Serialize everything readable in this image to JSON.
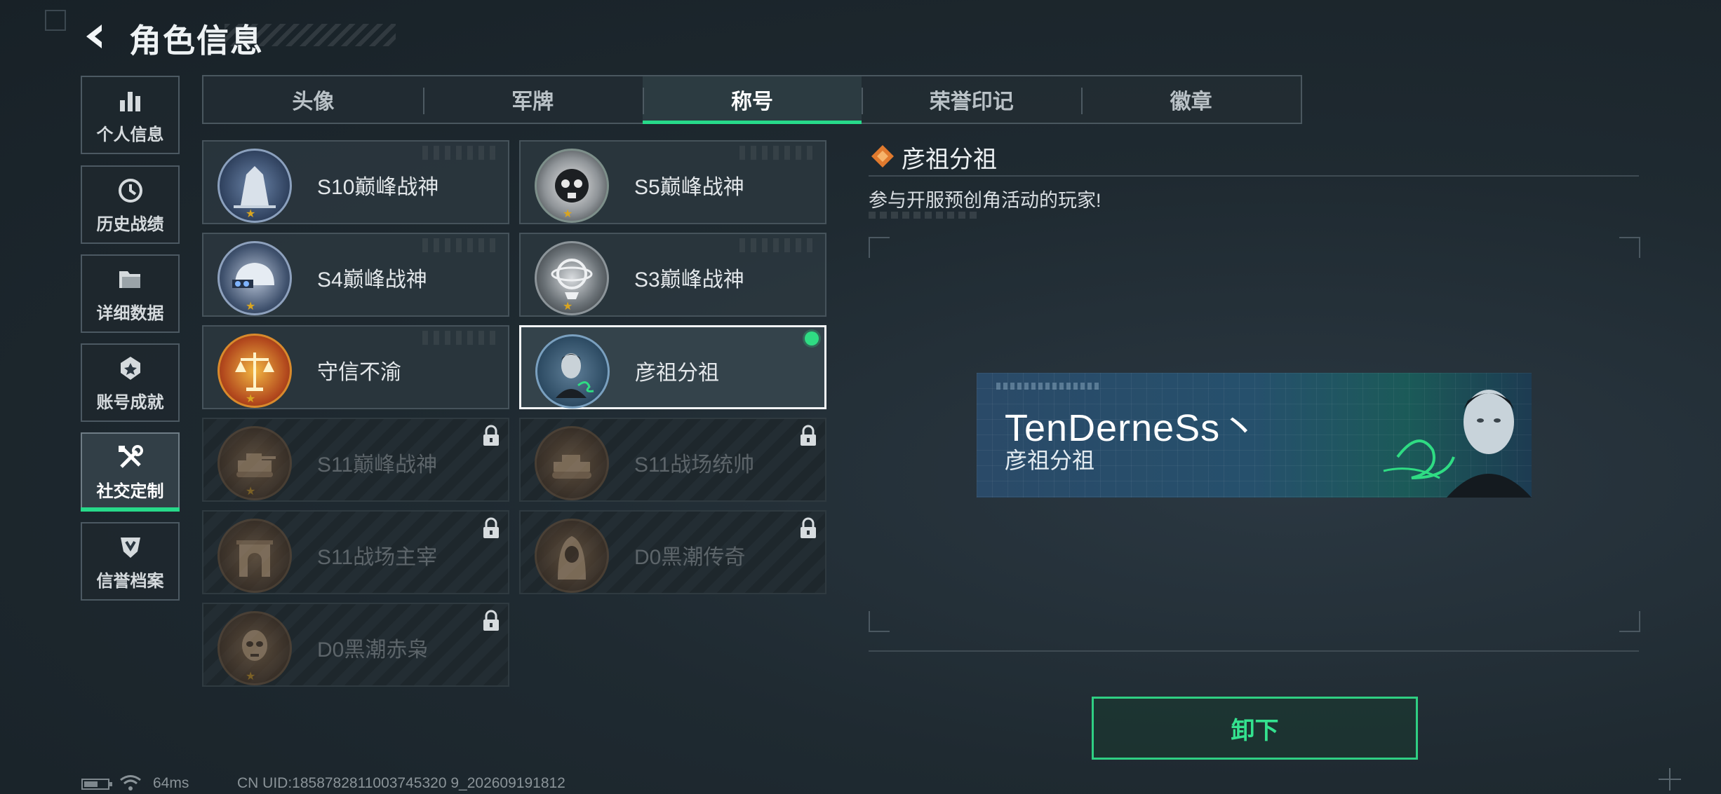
{
  "header": {
    "title": "角色信息",
    "back_icon": "back-arrow-icon"
  },
  "nav": {
    "items": [
      {
        "label": "个人信息",
        "icon": "bar-chart-icon"
      },
      {
        "label": "历史战绩",
        "icon": "clock-icon"
      },
      {
        "label": "详细数据",
        "icon": "folder-icon"
      },
      {
        "label": "账号成就",
        "icon": "medal-icon"
      },
      {
        "label": "社交定制",
        "icon": "tools-icon",
        "active": true
      },
      {
        "label": "信誉档案",
        "icon": "shield-icon"
      }
    ]
  },
  "tabs": [
    {
      "label": "头像"
    },
    {
      "label": "军牌"
    },
    {
      "label": "称号",
      "active": true
    },
    {
      "label": "荣誉印记"
    },
    {
      "label": "徽章"
    }
  ],
  "titles": [
    {
      "name": "S10巅峰战神",
      "locked": false,
      "emblem": "tower-emblem"
    },
    {
      "name": "S5巅峰战神",
      "locked": false,
      "emblem": "skull-emblem"
    },
    {
      "name": "S4巅峰战神",
      "locked": false,
      "emblem": "helmet-emblem"
    },
    {
      "name": "S3巅峰战神",
      "locked": false,
      "emblem": "globe-emblem"
    },
    {
      "name": "守信不渝",
      "locked": false,
      "emblem": "scales-emblem"
    },
    {
      "name": "彦祖分祖",
      "locked": false,
      "selected": true,
      "equipped": true,
      "emblem": "portrait-emblem"
    },
    {
      "name": "S11巅峰战神",
      "locked": true,
      "emblem": "tank-emblem"
    },
    {
      "name": "S11战场统帅",
      "locked": true,
      "emblem": "tank-emblem"
    },
    {
      "name": "S11战场主宰",
      "locked": true,
      "emblem": "arch-emblem"
    },
    {
      "name": "D0黑潮传奇",
      "locked": true,
      "emblem": "hooded-emblem"
    },
    {
      "name": "D0黑潮赤枭",
      "locked": true,
      "emblem": "skull-mask-emblem"
    }
  ],
  "detail": {
    "title": "彦祖分祖",
    "description": "参与开服预创角活动的玩家!",
    "banner": {
      "player_name": "TenDerneSs丶",
      "title": "彦祖分祖"
    },
    "unequip_label": "卸下"
  },
  "footer": {
    "ping": "64ms",
    "uid": "CN UID:1858782811003745320 9_202609191812",
    "battery_level": 0.6
  },
  "colors": {
    "accent": "#27d98a",
    "banner_blue": "#26506c"
  }
}
